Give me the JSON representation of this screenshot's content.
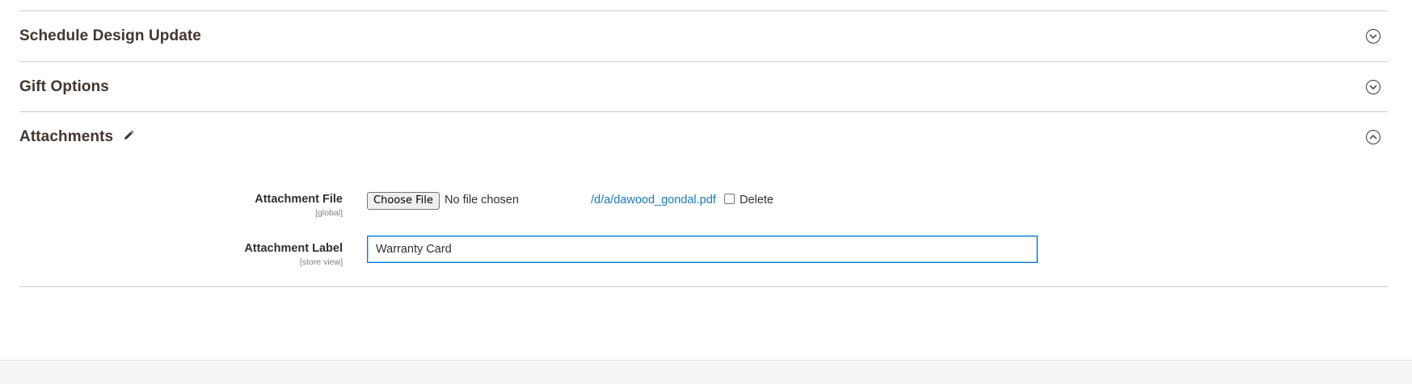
{
  "sections": [
    {
      "title": "Schedule Design Update",
      "state": "collapsed"
    },
    {
      "title": "Gift Options",
      "state": "collapsed"
    },
    {
      "title": "Attachments",
      "state": "expanded"
    }
  ],
  "attachments": {
    "file_field": {
      "label": "Attachment File",
      "scope": "[global]",
      "button_label": "Choose File",
      "status_text": "No file chosen",
      "existing_file_link": "/d/a/dawood_gondal.pdf",
      "delete_label": "Delete",
      "delete_checked": false
    },
    "label_field": {
      "label": "Attachment Label",
      "scope": "[store view]",
      "value": "Warranty Card"
    }
  },
  "icons": {
    "collapsed_toggle": "chevron-down-circle-icon",
    "expanded_toggle": "chevron-up-circle-icon",
    "edit": "pencil-icon"
  },
  "colors": {
    "link": "#1979c3",
    "focus_border": "#007bdb",
    "title": "#41362f",
    "divider": "#cccccc"
  }
}
